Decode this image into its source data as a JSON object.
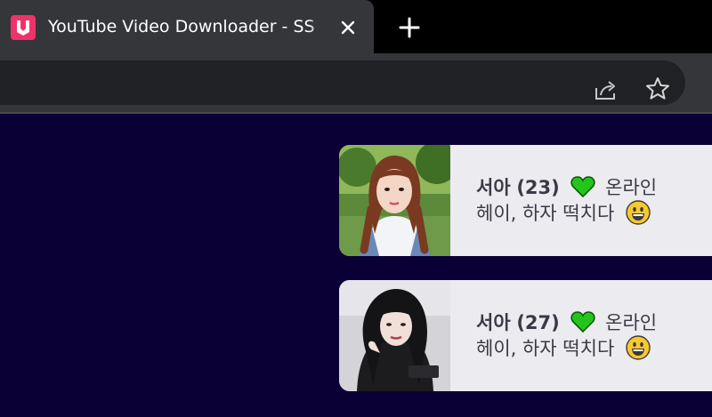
{
  "browser": {
    "tab_title": "YouTube Video Downloader - SS",
    "new_tab_symbol": "+",
    "close_symbol": "✕",
    "favicon_color": "#f0326b",
    "share_icon": "share-icon",
    "bookmark_icon": "star-icon"
  },
  "page": {
    "background_color": "#0a0035",
    "cards": [
      {
        "name": "서아",
        "age": "(23)",
        "status_icon": "green-heart",
        "status": "온라인",
        "message": "헤이, 하자 떡치다",
        "emoji": "grinning-face"
      },
      {
        "name": "서아",
        "age": "(27)",
        "status_icon": "green-heart",
        "status": "온라인",
        "message": "헤이, 하자 떡치다",
        "emoji": "grinning-face"
      }
    ]
  }
}
